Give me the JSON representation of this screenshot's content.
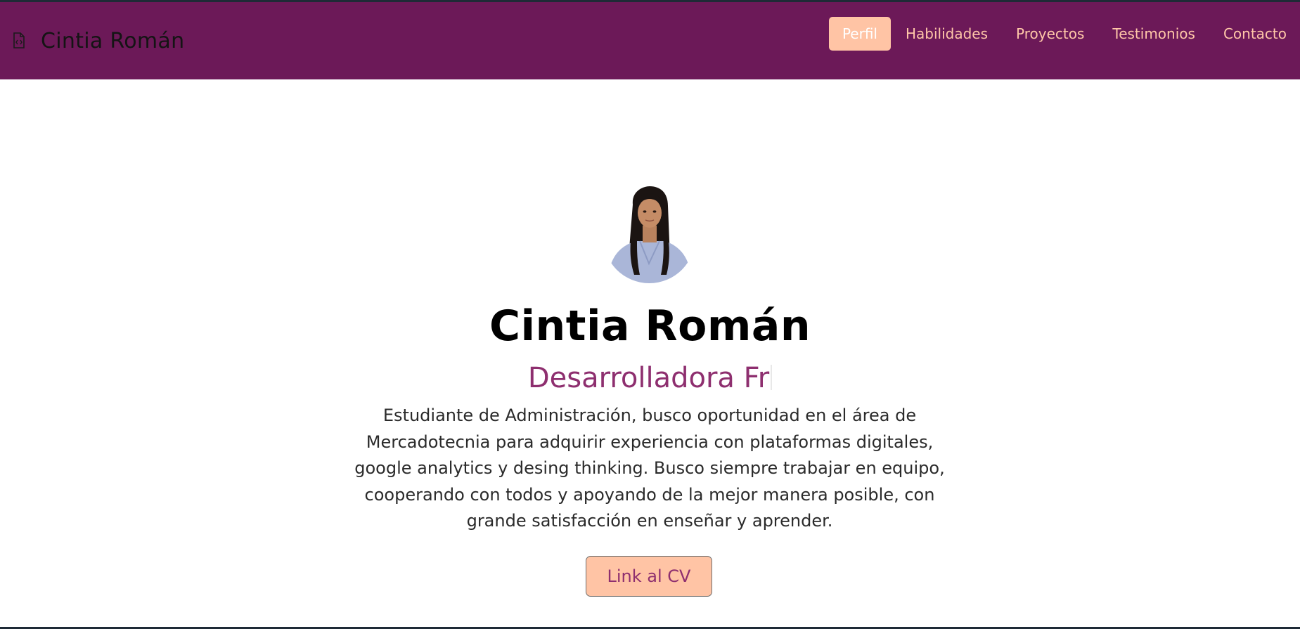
{
  "navbar": {
    "brand": {
      "icon": "file-code-icon",
      "name": "Cintia Román"
    },
    "items": [
      {
        "label": "Perfil",
        "active": true
      },
      {
        "label": "Habilidades",
        "active": false
      },
      {
        "label": "Proyectos",
        "active": false
      },
      {
        "label": "Testimonios",
        "active": false
      },
      {
        "label": "Contacto",
        "active": false
      }
    ]
  },
  "profile": {
    "name": "Cintia Román",
    "role_typed": "Desarrolladora Fr",
    "about": "Estudiante de Administración, busco oportunidad en el área de Mercadotecnia para adquirir experiencia con plataformas digitales, google analytics y desing thinking. Busco siempre trabajar en equipo, cooperando con todos y apoyando de la mejor manera posible, con grande satisfacción en enseñar y aprender.",
    "cv_button": "Link al CV"
  },
  "colors": {
    "navbar_bg": "#6c1958",
    "accent_peach": "#ffc4a5",
    "accent_magenta": "#8e2f6f",
    "nav_link": "#ffc7a8"
  }
}
